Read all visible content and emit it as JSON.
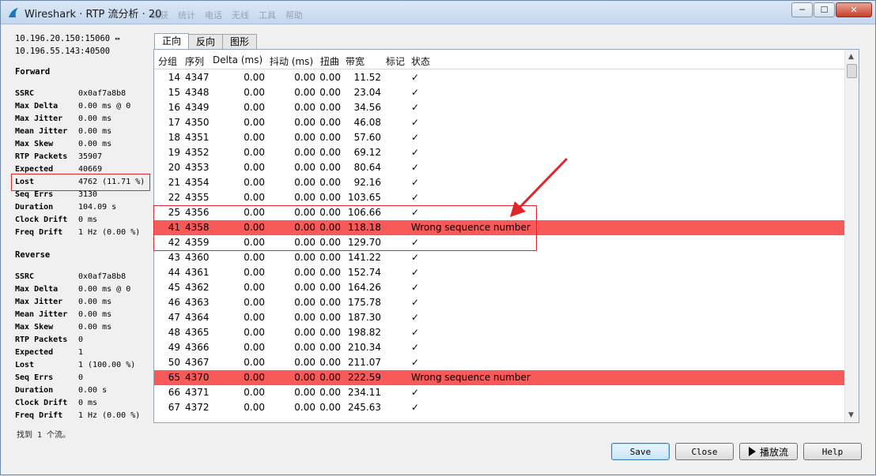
{
  "window": {
    "title": "Wireshark · RTP 流分析 · 20",
    "bg_toolbar": [
      "捕获",
      "统计",
      "电话",
      "无线",
      "工具",
      "帮助"
    ],
    "minimize": "─",
    "maximize": "☐",
    "close": "✕"
  },
  "endpoints": {
    "src": "10.196.20.150:15060 ↔",
    "dst": "10.196.55.143:40500"
  },
  "forward": {
    "title": "Forward",
    "rows": [
      {
        "k": "SSRC",
        "v": "0x0af7a8b8"
      },
      {
        "k": "Max Delta",
        "v": "0.00 ms @ 0"
      },
      {
        "k": "Max Jitter",
        "v": "0.00 ms"
      },
      {
        "k": "Mean Jitter",
        "v": "0.00 ms"
      },
      {
        "k": "Max Skew",
        "v": "0.00 ms"
      },
      {
        "k": "RTP Packets",
        "v": "35907"
      },
      {
        "k": "Expected",
        "v": "40669"
      },
      {
        "k": "Lost",
        "v": "4762 (11.71 %)"
      },
      {
        "k": "Seq Errs",
        "v": "3130"
      },
      {
        "k": "Duration",
        "v": "104.09 s"
      },
      {
        "k": "Clock Drift",
        "v": "0 ms"
      },
      {
        "k": "Freq Drift",
        "v": "1 Hz (0.00 %)"
      }
    ]
  },
  "reverse": {
    "title": "Reverse",
    "rows": [
      {
        "k": "SSRC",
        "v": "0x0af7a8b8"
      },
      {
        "k": "Max Delta",
        "v": "0.00 ms @ 0"
      },
      {
        "k": "Max Jitter",
        "v": "0.00 ms"
      },
      {
        "k": "Mean Jitter",
        "v": "0.00 ms"
      },
      {
        "k": "Max Skew",
        "v": "0.00 ms"
      },
      {
        "k": "RTP Packets",
        "v": "0"
      },
      {
        "k": "Expected",
        "v": "1"
      },
      {
        "k": "Lost",
        "v": "1 (100.00 %)"
      },
      {
        "k": "Seq Errs",
        "v": "0"
      },
      {
        "k": "Duration",
        "v": "0.00 s"
      },
      {
        "k": "Clock Drift",
        "v": "0 ms"
      },
      {
        "k": "Freq Drift",
        "v": "1 Hz (0.00 %)"
      }
    ]
  },
  "found_text": "找到 1 个流。",
  "tabs": [
    "正向",
    "反向",
    "图形"
  ],
  "columns": [
    "分组",
    "序列",
    "Delta (ms)",
    "抖动 (ms)",
    "扭曲",
    "带宽",
    "标记",
    "状态"
  ],
  "rows": [
    {
      "pkt": "14",
      "seq": "4347",
      "delta": "0.00",
      "jitter": "0.00",
      "skew": "0.00",
      "bw": "11.52",
      "status": "✓",
      "err": false
    },
    {
      "pkt": "15",
      "seq": "4348",
      "delta": "0.00",
      "jitter": "0.00",
      "skew": "0.00",
      "bw": "23.04",
      "status": "✓",
      "err": false
    },
    {
      "pkt": "16",
      "seq": "4349",
      "delta": "0.00",
      "jitter": "0.00",
      "skew": "0.00",
      "bw": "34.56",
      "status": "✓",
      "err": false
    },
    {
      "pkt": "17",
      "seq": "4350",
      "delta": "0.00",
      "jitter": "0.00",
      "skew": "0.00",
      "bw": "46.08",
      "status": "✓",
      "err": false
    },
    {
      "pkt": "18",
      "seq": "4351",
      "delta": "0.00",
      "jitter": "0.00",
      "skew": "0.00",
      "bw": "57.60",
      "status": "✓",
      "err": false
    },
    {
      "pkt": "19",
      "seq": "4352",
      "delta": "0.00",
      "jitter": "0.00",
      "skew": "0.00",
      "bw": "69.12",
      "status": "✓",
      "err": false
    },
    {
      "pkt": "20",
      "seq": "4353",
      "delta": "0.00",
      "jitter": "0.00",
      "skew": "0.00",
      "bw": "80.64",
      "status": "✓",
      "err": false
    },
    {
      "pkt": "21",
      "seq": "4354",
      "delta": "0.00",
      "jitter": "0.00",
      "skew": "0.00",
      "bw": "92.16",
      "status": "✓",
      "err": false
    },
    {
      "pkt": "22",
      "seq": "4355",
      "delta": "0.00",
      "jitter": "0.00",
      "skew": "0.00",
      "bw": "103.65",
      "status": "✓",
      "err": false
    },
    {
      "pkt": "25",
      "seq": "4356",
      "delta": "0.00",
      "jitter": "0.00",
      "skew": "0.00",
      "bw": "106.66",
      "status": "✓",
      "err": false
    },
    {
      "pkt": "41",
      "seq": "4358",
      "delta": "0.00",
      "jitter": "0.00",
      "skew": "0.00",
      "bw": "118.18",
      "status": "Wrong sequence number",
      "err": true
    },
    {
      "pkt": "42",
      "seq": "4359",
      "delta": "0.00",
      "jitter": "0.00",
      "skew": "0.00",
      "bw": "129.70",
      "status": "✓",
      "err": false
    },
    {
      "pkt": "43",
      "seq": "4360",
      "delta": "0.00",
      "jitter": "0.00",
      "skew": "0.00",
      "bw": "141.22",
      "status": "✓",
      "err": false
    },
    {
      "pkt": "44",
      "seq": "4361",
      "delta": "0.00",
      "jitter": "0.00",
      "skew": "0.00",
      "bw": "152.74",
      "status": "✓",
      "err": false
    },
    {
      "pkt": "45",
      "seq": "4362",
      "delta": "0.00",
      "jitter": "0.00",
      "skew": "0.00",
      "bw": "164.26",
      "status": "✓",
      "err": false
    },
    {
      "pkt": "46",
      "seq": "4363",
      "delta": "0.00",
      "jitter": "0.00",
      "skew": "0.00",
      "bw": "175.78",
      "status": "✓",
      "err": false
    },
    {
      "pkt": "47",
      "seq": "4364",
      "delta": "0.00",
      "jitter": "0.00",
      "skew": "0.00",
      "bw": "187.30",
      "status": "✓",
      "err": false
    },
    {
      "pkt": "48",
      "seq": "4365",
      "delta": "0.00",
      "jitter": "0.00",
      "skew": "0.00",
      "bw": "198.82",
      "status": "✓",
      "err": false
    },
    {
      "pkt": "49",
      "seq": "4366",
      "delta": "0.00",
      "jitter": "0.00",
      "skew": "0.00",
      "bw": "210.34",
      "status": "✓",
      "err": false
    },
    {
      "pkt": "50",
      "seq": "4367",
      "delta": "0.00",
      "jitter": "0.00",
      "skew": "0.00",
      "bw": "211.07",
      "status": "✓",
      "err": false
    },
    {
      "pkt": "65",
      "seq": "4370",
      "delta": "0.00",
      "jitter": "0.00",
      "skew": "0.00",
      "bw": "222.59",
      "status": "Wrong sequence number",
      "err": true
    },
    {
      "pkt": "66",
      "seq": "4371",
      "delta": "0.00",
      "jitter": "0.00",
      "skew": "0.00",
      "bw": "234.11",
      "status": "✓",
      "err": false
    },
    {
      "pkt": "67",
      "seq": "4372",
      "delta": "0.00",
      "jitter": "0.00",
      "skew": "0.00",
      "bw": "245.63",
      "status": "✓",
      "err": false
    }
  ],
  "buttons": {
    "save": "Save",
    "close": "Close",
    "play": "播放流",
    "help": "Help"
  },
  "colors": {
    "error_row": "#f85a5a",
    "annotation": "#e0262a"
  }
}
